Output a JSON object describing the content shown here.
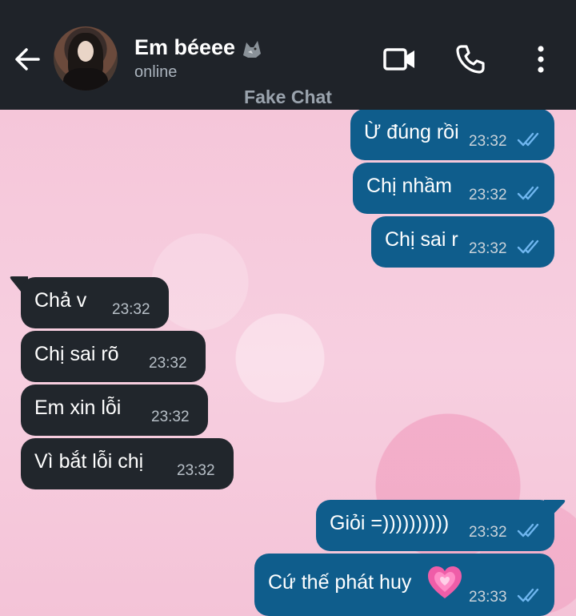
{
  "header": {
    "contact_name": "Em béeee",
    "name_emoji_icon": "wolf-icon",
    "status": "online",
    "watermark": "Fake Chat"
  },
  "messages": [
    {
      "direction": "out",
      "text": "Ừ đúng rồi",
      "time": "23:32",
      "read": true
    },
    {
      "direction": "out",
      "text": "Chị nhầm",
      "time": "23:32",
      "read": true
    },
    {
      "direction": "out",
      "text": "Chị sai r",
      "time": "23:32",
      "read": true
    },
    {
      "direction": "in",
      "text": "Chả v",
      "time": "23:32"
    },
    {
      "direction": "in",
      "text": "Chị sai rõ",
      "time": "23:32"
    },
    {
      "direction": "in",
      "text": "Em xin lỗi",
      "time": "23:32"
    },
    {
      "direction": "in",
      "text": "Vì bắt lỗi chị",
      "time": "23:32"
    },
    {
      "direction": "out",
      "text": "Giỏi =))))))))))",
      "time": "23:32",
      "read": true
    },
    {
      "direction": "out",
      "text": "Cứ thế phát huy",
      "time": "23:33",
      "read": true,
      "emoji_icon": "growing-heart-icon"
    }
  ],
  "colors": {
    "header_bg": "#1f2329",
    "outgoing_bubble": "#0f5d8c",
    "incoming_bubble": "#21262c",
    "read_ticks": "#6fb6ef"
  }
}
